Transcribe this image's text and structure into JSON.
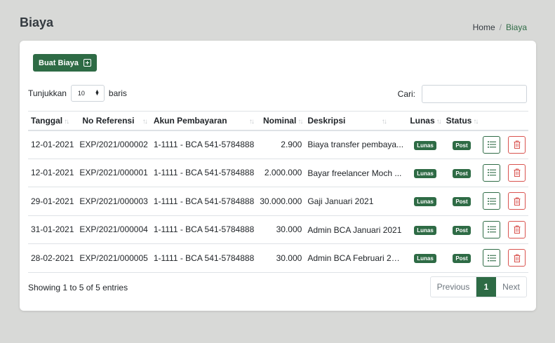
{
  "page": {
    "title": "Biaya"
  },
  "breadcrumb": {
    "home": "Home",
    "separator": "/",
    "current": "Biaya"
  },
  "toolbar": {
    "create_label": "Buat Biaya"
  },
  "length": {
    "prefix": "Tunjukkan",
    "value": "10",
    "suffix": "baris"
  },
  "search": {
    "label": "Cari:",
    "value": ""
  },
  "table": {
    "headers": [
      "Tanggal",
      "No Referensi",
      "Akun Pembayaran",
      "Nominal",
      "Deskripsi",
      "Lunas",
      "Status"
    ],
    "rows": [
      {
        "tanggal": "12-01-2021",
        "ref": "EXP/2021/000002",
        "akun": "1-1111 - BCA 541-5784888",
        "nominal": "2.900",
        "deskripsi": "Biaya transfer pembaya...",
        "lunas": "Lunas",
        "status": "Post"
      },
      {
        "tanggal": "12-01-2021",
        "ref": "EXP/2021/000001",
        "akun": "1-1111 - BCA 541-5784888",
        "nominal": "2.000.000",
        "deskripsi": "Bayar freelancer Moch ...",
        "lunas": "Lunas",
        "status": "Post"
      },
      {
        "tanggal": "29-01-2021",
        "ref": "EXP/2021/000003",
        "akun": "1-1111 - BCA 541-5784888",
        "nominal": "30.000.000",
        "deskripsi": "Gaji Januari 2021",
        "lunas": "Lunas",
        "status": "Post"
      },
      {
        "tanggal": "31-01-2021",
        "ref": "EXP/2021/000004",
        "akun": "1-1111 - BCA 541-5784888",
        "nominal": "30.000",
        "deskripsi": "Admin BCA Januari 2021",
        "lunas": "Lunas",
        "status": "Post"
      },
      {
        "tanggal": "28-02-2021",
        "ref": "EXP/2021/000005",
        "akun": "1-1111 - BCA 541-5784888",
        "nominal": "30.000",
        "deskripsi": "Admin BCA Februari 202...",
        "lunas": "Lunas",
        "status": "Post"
      }
    ]
  },
  "footer": {
    "info": "Showing 1 to 5 of 5 entries"
  },
  "pagination": {
    "prev": "Previous",
    "current": "1",
    "next": "Next"
  },
  "colors": {
    "primary": "#2e6b45",
    "danger": "#d9534f",
    "background": "#d8d9d7"
  }
}
